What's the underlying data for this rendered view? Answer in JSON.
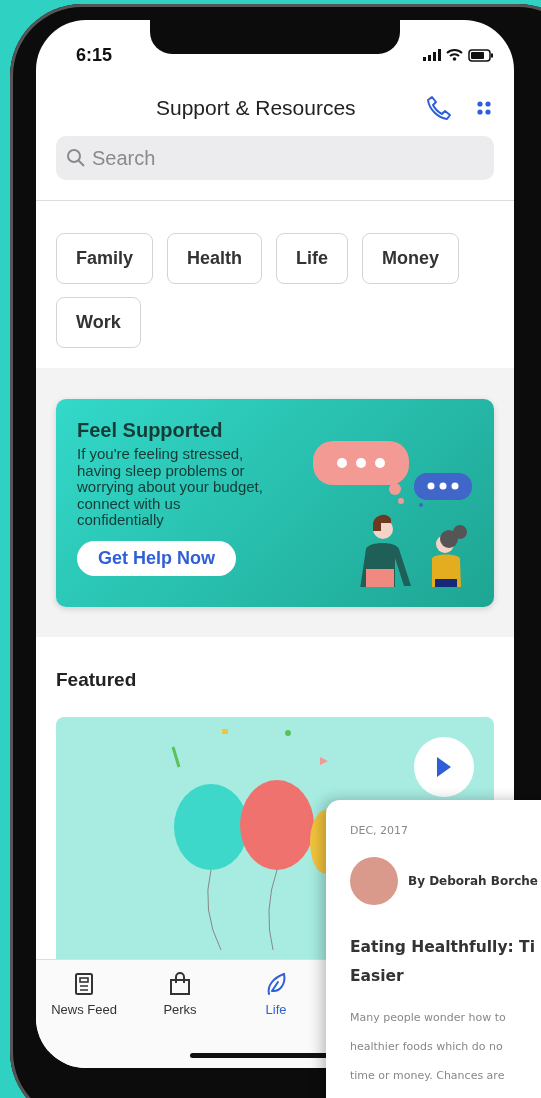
{
  "status_bar": {
    "time": "6:15"
  },
  "header": {
    "title": "Support & Resources"
  },
  "search": {
    "placeholder": "Search"
  },
  "categories": [
    {
      "label": "Family"
    },
    {
      "label": "Health"
    },
    {
      "label": "Life"
    },
    {
      "label": "Money"
    },
    {
      "label": "Work"
    }
  ],
  "banner": {
    "title": "Feel Supported",
    "text": "If you're feeling stressed, having sleep problems or worrying about your budget, connect with us confidentially",
    "button": "Get Help Now"
  },
  "featured": {
    "heading": "Featured"
  },
  "tab_bar": [
    {
      "label": "News Feed",
      "selected": false
    },
    {
      "label": "Perks",
      "selected": false
    },
    {
      "label": "Life",
      "selected": true
    }
  ],
  "article_card": {
    "date": "DEC, 2017",
    "author": "By Deborah Borche",
    "title_lines": [
      "Eating Healthfully: Ti",
      "Easier"
    ],
    "body_lines": [
      "Many people wonder how to",
      "healthier foods which do no",
      "time or money. Chances are"
    ]
  }
}
